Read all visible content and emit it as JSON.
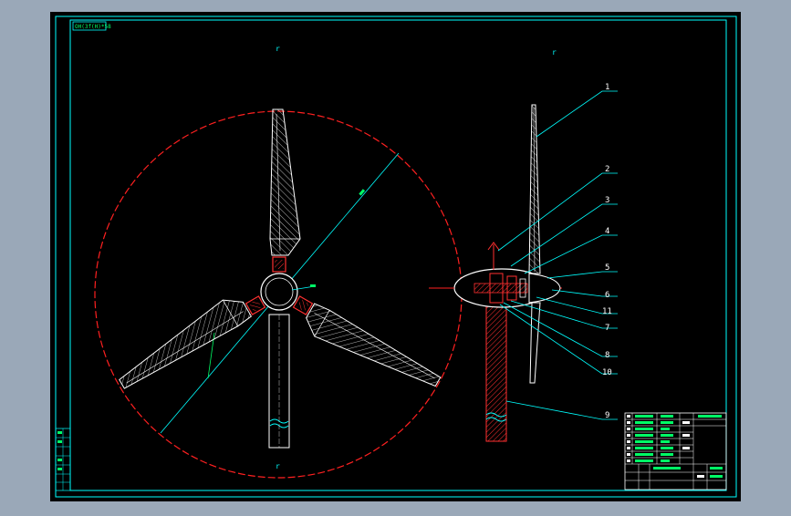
{
  "drawing": {
    "stamp": "OH(3f(H)*58",
    "mark_top_left": "r",
    "mark_top_right": "r",
    "mark_bottom_left": "r",
    "mark_center": "",
    "part_labels": [
      "1",
      "2",
      "3",
      "4",
      "5",
      "6",
      "11",
      "7",
      "8",
      "10",
      "9"
    ]
  },
  "colors": {
    "background": "#000000",
    "frame": "#00ffff",
    "outline": "#ffffff",
    "circle": "#ff2020",
    "hatch": "#ff3030",
    "green": "#00ff66",
    "gray_bg": "#9aa8b8"
  }
}
